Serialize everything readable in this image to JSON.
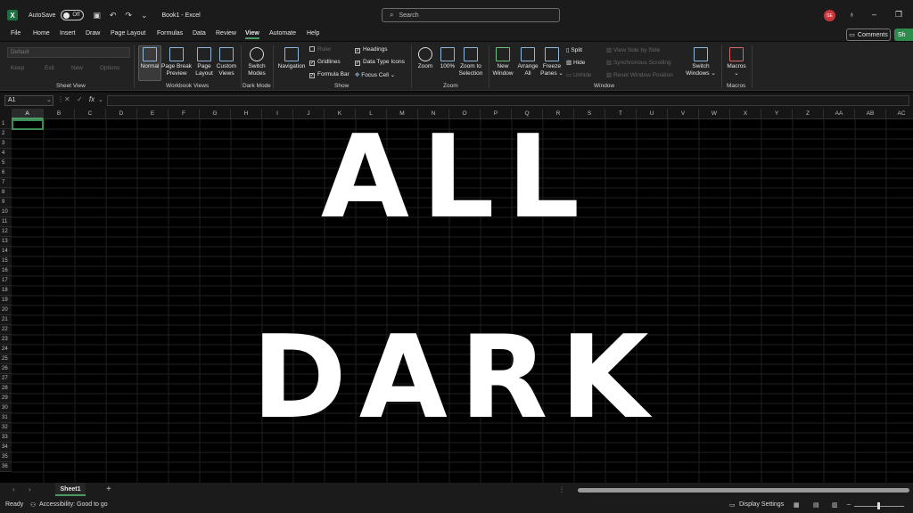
{
  "titlebar": {
    "autosave_label": "AutoSave",
    "autosave_state": "Off",
    "doc_title": "Book1 - Excel",
    "search_placeholder": "Search",
    "avatar_initials": "SE"
  },
  "menu": {
    "tabs": [
      "File",
      "Home",
      "Insert",
      "Draw",
      "Page Layout",
      "Formulas",
      "Data",
      "Review",
      "View",
      "Automate",
      "Help"
    ],
    "active": "View",
    "comments_label": "Comments",
    "share_label": "Sh"
  },
  "ribbon": {
    "sheet_view": {
      "combo_value": "Default",
      "keep": "Keep",
      "exit": "Exit",
      "new": "New",
      "options": "Options",
      "label": "Sheet View"
    },
    "workbook_views": {
      "normal": "Normal",
      "page_break_1": "Page Break",
      "page_break_2": "Preview",
      "page_layout_1": "Page",
      "page_layout_2": "Layout",
      "custom_1": "Custom",
      "custom_2": "Views",
      "label": "Workbook Views"
    },
    "dark_mode": {
      "switch_1": "Switch",
      "switch_2": "Modes",
      "label": "Dark Mode"
    },
    "show": {
      "navigation": "Navigation",
      "ruler": "Ruler",
      "gridlines": "Gridlines",
      "formula_bar": "Formula Bar",
      "headings": "Headings",
      "data_type_icons": "Data Type Icons",
      "focus_cell": "Focus Cell",
      "label": "Show"
    },
    "zoom": {
      "zoom": "Zoom",
      "hundred": "100%",
      "zoom_sel_1": "Zoom to",
      "zoom_sel_2": "Selection",
      "label": "Zoom"
    },
    "window": {
      "new_1": "New",
      "new_2": "Window",
      "arrange_1": "Arrange",
      "arrange_2": "All",
      "freeze_1": "Freeze",
      "freeze_2": "Panes",
      "split": "Split",
      "hide": "Hide",
      "unhide": "Unhide",
      "side_by_side": "View Side by Side",
      "sync_scroll": "Synchronous Scrolling",
      "reset_pos": "Reset Window Position",
      "switch_1": "Switch",
      "switch_2": "Windows",
      "label": "Window"
    },
    "macros": {
      "macros": "Macros",
      "label": "Macros"
    }
  },
  "formulabar": {
    "namebox": "A1",
    "fx": "fx"
  },
  "grid": {
    "columns": [
      "A",
      "B",
      "C",
      "D",
      "E",
      "F",
      "G",
      "H",
      "I",
      "J",
      "K",
      "L",
      "M",
      "N",
      "O",
      "P",
      "Q",
      "R",
      "S",
      "T",
      "U",
      "V",
      "W",
      "X",
      "Y",
      "Z",
      "AA",
      "AB",
      "AC"
    ],
    "rows": [
      "1",
      "2",
      "3",
      "4",
      "5",
      "6",
      "7",
      "8",
      "9",
      "10",
      "11",
      "12",
      "13",
      "14",
      "15",
      "16",
      "17",
      "18",
      "19",
      "20",
      "21",
      "22",
      "23",
      "24",
      "25",
      "26",
      "27",
      "28",
      "29",
      "30",
      "31",
      "32",
      "33",
      "34",
      "35",
      "36"
    ]
  },
  "overlay": {
    "line1": "ALL",
    "line2": "DARK"
  },
  "sheets": {
    "tab": "Sheet1",
    "add": "+"
  },
  "status": {
    "ready": "Ready",
    "accessibility": "Accessibility: Good to go",
    "display_settings": "Display Settings"
  }
}
